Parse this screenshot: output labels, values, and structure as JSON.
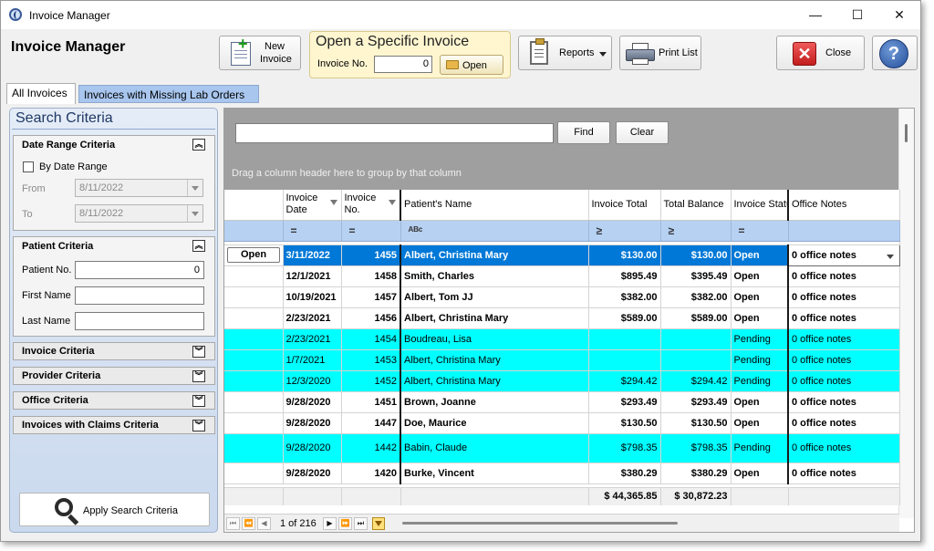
{
  "window": {
    "title": "Invoice Manager",
    "minimize": "—",
    "maximize": "☐",
    "close": "✕"
  },
  "app_title": "Invoice Manager",
  "toolbar": {
    "new_invoice_line1": "New",
    "new_invoice_line2": "Invoice",
    "open_specific_title": "Open a Specific Invoice",
    "invoice_no_label": "Invoice No.",
    "invoice_no_value": "0",
    "open_label": "Open",
    "reports_label": "Reports",
    "print_list_label": "Print List",
    "close_label": "Close",
    "help_glyph": "?"
  },
  "tabs": [
    {
      "label": "All Invoices",
      "active": true
    },
    {
      "label": "Invoices with Missing Lab Orders",
      "active": false
    }
  ],
  "search_criteria": {
    "title": "Search Criteria",
    "date_range": {
      "title": "Date Range Criteria",
      "by_date_range_label": "By Date Range",
      "from_label": "From",
      "from_value": "8/11/2022",
      "to_label": "To",
      "to_value": "8/11/2022"
    },
    "patient": {
      "title": "Patient Criteria",
      "patient_no_label": "Patient No.",
      "patient_no_value": "0",
      "first_name_label": "First Name",
      "last_name_label": "Last Name"
    },
    "collapsed_sections": [
      "Invoice Criteria",
      "Provider Criteria",
      "Office Criteria",
      "Invoices with Claims Criteria"
    ],
    "apply_label": "Apply Search Criteria"
  },
  "grid": {
    "find_label": "Find",
    "clear_label": "Clear",
    "group_hint": "Drag a column header here to group by that column",
    "columns": {
      "invoice_date_1": "Invoice",
      "invoice_date_2": "Date",
      "invoice_no_1": "Invoice",
      "invoice_no_2": "No.",
      "patient_name": "Patient's Name",
      "invoice_total": "Invoice Total",
      "total_balance": "Total Balance",
      "invoice_status": "Invoice Status",
      "office_notes": "Office Notes"
    },
    "filter_glyphs": {
      "equals": "=",
      "text": "ᴬᴮᶜ",
      "gte": "≥"
    },
    "row_open_label": "Open",
    "rows": [
      {
        "date": "3/11/2022",
        "no": "1455",
        "patient": "Albert, Christina Mary",
        "total": "$130.00",
        "balance": "$130.00",
        "status": "Open",
        "notes": "0 office notes"
      },
      {
        "date": "12/1/2021",
        "no": "1458",
        "patient": "Smith, Charles",
        "total": "$895.49",
        "balance": "$395.49",
        "status": "Open",
        "notes": "0 office notes"
      },
      {
        "date": "10/19/2021",
        "no": "1457",
        "patient": "Albert, Tom JJ",
        "total": "$382.00",
        "balance": "$382.00",
        "status": "Open",
        "notes": "0 office notes"
      },
      {
        "date": "2/23/2021",
        "no": "1456",
        "patient": "Albert, Christina Mary",
        "total": "$589.00",
        "balance": "$589.00",
        "status": "Open",
        "notes": "0 office notes"
      },
      {
        "date": "2/23/2021",
        "no": "1454",
        "patient": "Boudreau, Lisa",
        "total": "",
        "balance": "",
        "status": "Pending",
        "notes": "0 office notes"
      },
      {
        "date": "1/7/2021",
        "no": "1453",
        "patient": "Albert, Christina Mary",
        "total": "",
        "balance": "",
        "status": "Pending",
        "notes": "0 office notes"
      },
      {
        "date": "12/3/2020",
        "no": "1452",
        "patient": "Albert, Christina Mary",
        "total": "$294.42",
        "balance": "$294.42",
        "status": "Pending",
        "notes": "0 office notes"
      },
      {
        "date": "9/28/2020",
        "no": "1451",
        "patient": "Brown, Joanne",
        "total": "$293.49",
        "balance": "$293.49",
        "status": "Open",
        "notes": "0 office notes"
      },
      {
        "date": "9/28/2020",
        "no": "1447",
        "patient": "Doe, Maurice",
        "total": "$130.50",
        "balance": "$130.50",
        "status": "Open",
        "notes": "0 office notes"
      },
      {
        "date": "9/28/2020",
        "no": "1442",
        "patient": "Babin, Claude",
        "total": "$798.35",
        "balance": "$798.35",
        "status": "Pending",
        "notes": "0 office notes"
      },
      {
        "date": "9/28/2020",
        "no": "1420",
        "patient": "Burke, Vincent",
        "total": "$380.29",
        "balance": "$380.29",
        "status": "Open",
        "notes": "0 office notes"
      }
    ],
    "summary": {
      "invoice_total": "$ 44,365.85",
      "total_balance": "$ 30,872.23"
    },
    "pager": {
      "page_text": "1 of 216"
    }
  },
  "colors": {
    "selection": "#0078d7",
    "pending_row": "#00ffff",
    "filter_row": "#b6d1f2",
    "tab_inactive": "#a8c6ee"
  }
}
